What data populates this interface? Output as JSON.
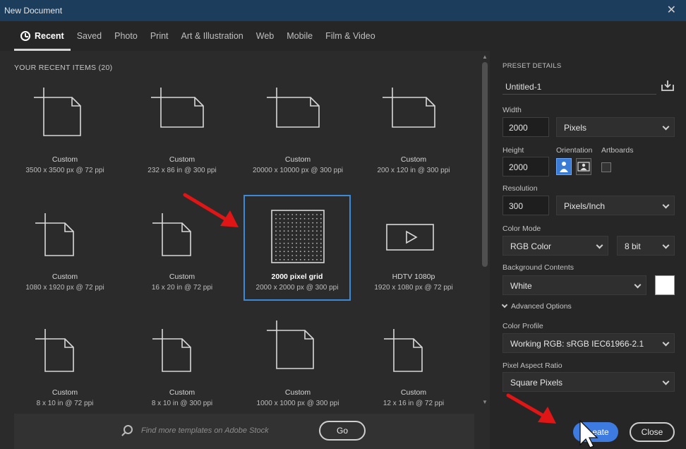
{
  "window": {
    "title": "New Document"
  },
  "tabs": [
    {
      "label": "Recent",
      "active": true,
      "icon": "clock-icon"
    },
    {
      "label": "Saved"
    },
    {
      "label": "Photo"
    },
    {
      "label": "Print"
    },
    {
      "label": "Art & Illustration"
    },
    {
      "label": "Web"
    },
    {
      "label": "Mobile"
    },
    {
      "label": "Film & Video"
    }
  ],
  "recent": {
    "title": "YOUR RECENT ITEMS  (20)",
    "items": [
      {
        "name": "Custom",
        "dims": "3500 x 3500 px @ 72 ppi",
        "shape": "square"
      },
      {
        "name": "Custom",
        "dims": "232 x 86 in @ 300 ppi",
        "shape": "wide"
      },
      {
        "name": "Custom",
        "dims": "20000 x 10000 px @ 300 ppi",
        "shape": "wide"
      },
      {
        "name": "Custom",
        "dims": "200 x 120 in @ 300 ppi",
        "shape": "wide"
      },
      {
        "name": "Custom",
        "dims": "1080 x 1920 px @ 72 ppi",
        "shape": "tall"
      },
      {
        "name": "Custom",
        "dims": "16 x 20 in @ 72 ppi",
        "shape": "tall"
      },
      {
        "name": "2000 pixel grid",
        "dims": "2000 x 2000 px @ 300 ppi",
        "shape": "grid",
        "selected": true
      },
      {
        "name": "HDTV 1080p",
        "dims": "1920 x 1080 px @ 72 ppi",
        "shape": "video"
      },
      {
        "name": "Custom",
        "dims": "8 x 10 in @ 72 ppi",
        "shape": "tall"
      },
      {
        "name": "Custom",
        "dims": "8 x 10 in @ 300 ppi",
        "shape": "tall"
      },
      {
        "name": "Custom",
        "dims": "1000 x 1000 px @ 300 ppi",
        "shape": "square"
      },
      {
        "name": "Custom",
        "dims": "12 x 16 in @ 72 ppi",
        "shape": "tall"
      }
    ]
  },
  "search": {
    "placeholder": "Find more templates on Adobe Stock",
    "go_label": "Go"
  },
  "preset": {
    "title": "PRESET DETAILS",
    "doc_name": "Untitled-1",
    "width_label": "Width",
    "width_value": "2000",
    "width_unit": "Pixels",
    "height_label": "Height",
    "height_value": "2000",
    "orientation_label": "Orientation",
    "artboards_label": "Artboards",
    "resolution_label": "Resolution",
    "resolution_value": "300",
    "resolution_unit": "Pixels/Inch",
    "color_mode_label": "Color Mode",
    "color_mode": "RGB Color",
    "bit_depth": "8 bit",
    "bg_label": "Background Contents",
    "bg_value": "White",
    "advanced_label": "Advanced Options",
    "profile_label": "Color Profile",
    "profile_value": "Working RGB: sRGB IEC61966-2.1",
    "aspect_label": "Pixel Aspect Ratio",
    "aspect_value": "Square Pixels"
  },
  "actions": {
    "create_label": "eate",
    "close_label": "Close"
  },
  "colors": {
    "accent": "#3d7be0",
    "titlebar": "#1d3d5c",
    "arrow": "#e01515"
  }
}
